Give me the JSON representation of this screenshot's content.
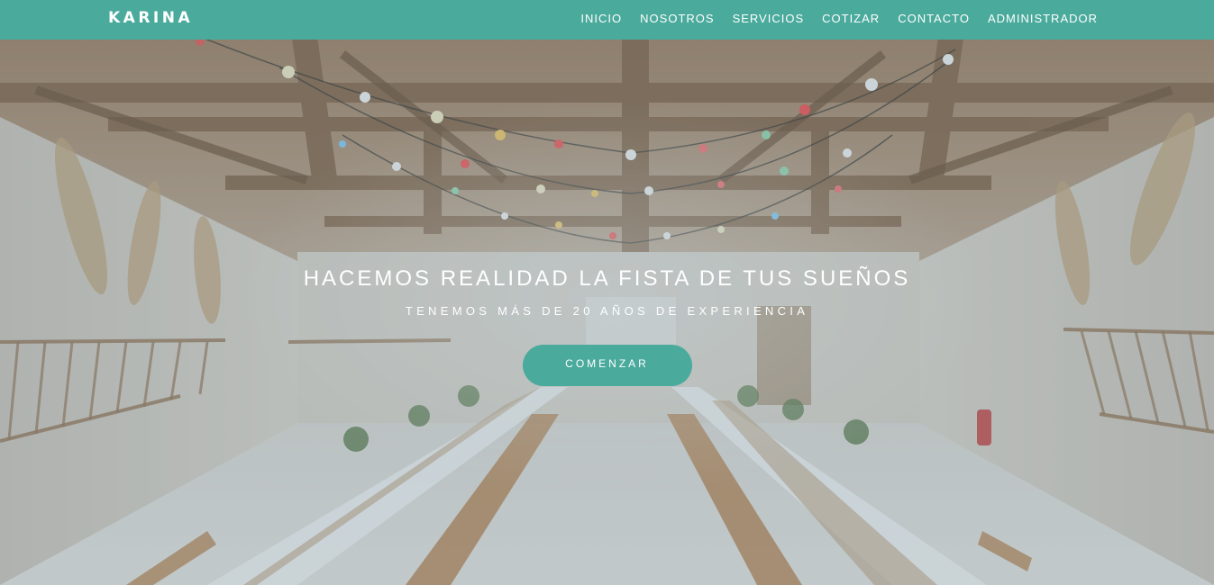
{
  "brand": {
    "name": "KARINA",
    "accent_color": "#4aaa9c"
  },
  "nav": {
    "items": [
      {
        "label": "INICIO"
      },
      {
        "label": "NOSOTROS"
      },
      {
        "label": "SERVICIOS"
      },
      {
        "label": "COTIZAR"
      },
      {
        "label": "CONTACTO"
      },
      {
        "label": "ADMINISTRADOR"
      }
    ]
  },
  "hero": {
    "title": "HACEMOS REALIDAD LA FISTA DE TUS SUEÑOS",
    "subtitle": "TENEMOS MÁS DE 20 AÑOS DE EXPERIENCIA",
    "cta_label": "COMENZAR"
  }
}
